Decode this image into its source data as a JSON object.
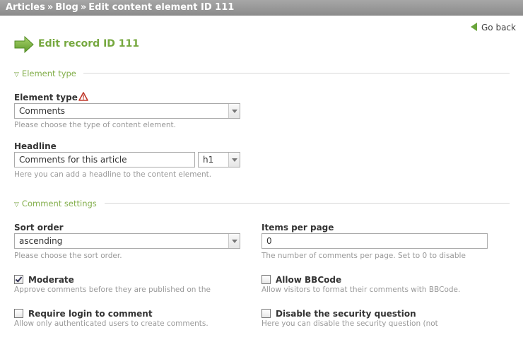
{
  "breadcrumb": {
    "items": [
      "Articles",
      "Blog"
    ],
    "separator": "»",
    "current": "Edit content element ID 111"
  },
  "header": {
    "go_back": "Go back",
    "title": "Edit record ID 111"
  },
  "sections": {
    "element_type": "Element type",
    "comment_settings": "Comment settings"
  },
  "fields": {
    "element_type": {
      "label": "Element type",
      "value": "Comments",
      "hint": "Please choose the type of content element."
    },
    "headline": {
      "label": "Headline",
      "value": "Comments for this article",
      "level": "h1",
      "hint": "Here you can add a headline to the content element."
    },
    "sort_order": {
      "label": "Sort order",
      "value": "ascending",
      "hint": "Please choose the sort order."
    },
    "items_per_page": {
      "label": "Items per page",
      "value": "0",
      "hint": "The number of comments per page. Set to 0 to disable"
    },
    "moderate": {
      "label": "Moderate",
      "checked": true,
      "hint": "Approve comments before they are published on the"
    },
    "allow_bbcode": {
      "label": "Allow BBCode",
      "checked": false,
      "hint": "Allow visitors to format their comments with BBCode."
    },
    "require_login": {
      "label": "Require login to comment",
      "checked": false,
      "hint": "Allow only authenticated users to create comments."
    },
    "disable_captcha": {
      "label": "Disable the security question",
      "checked": false,
      "hint": "Here you can disable the security question (not"
    }
  },
  "colors": {
    "accent": "#76a83f",
    "legend": "#82ae4a",
    "topbar": "#9a9a9a",
    "hint": "#999999"
  },
  "icons": {
    "go_back": "back-arrow-icon",
    "title": "green-arrow-icon",
    "warning": "warning-triangle-icon"
  }
}
